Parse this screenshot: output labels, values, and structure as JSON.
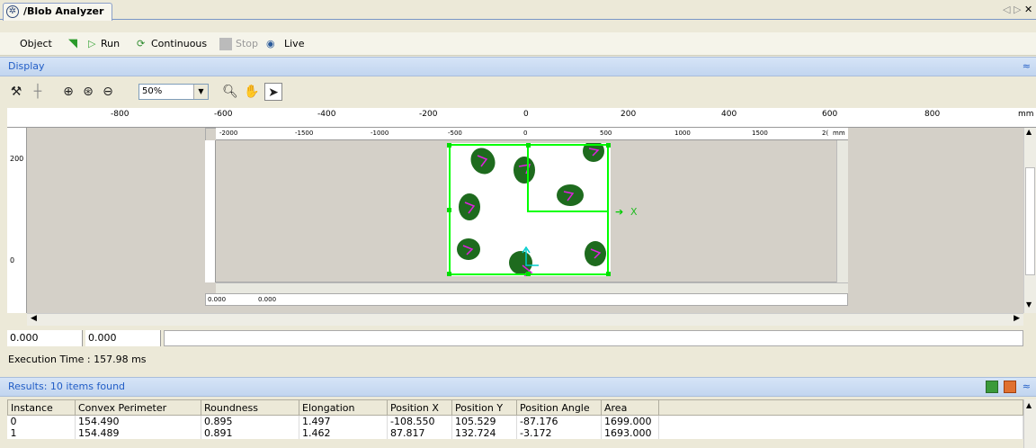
{
  "tab": {
    "title": "/Blob Analyzer"
  },
  "toolbar": {
    "object": "Object",
    "run": "Run",
    "continuous": "Continuous",
    "stop": "Stop",
    "live": "Live"
  },
  "display": {
    "header": "Display",
    "zoom": "50%"
  },
  "ruler": {
    "top": [
      "-800",
      "-600",
      "-400",
      "-200",
      "0",
      "200",
      "400",
      "600",
      "800",
      "mm"
    ],
    "left": [
      "200",
      "0"
    ],
    "inner_top": [
      "-2000",
      "-1500",
      "-1000",
      "-500",
      "0",
      "500",
      "1000",
      "1500",
      "2(",
      "mm"
    ]
  },
  "overlay": {
    "x_label": "X"
  },
  "inner_coords": {
    "a": "0.000",
    "b": "0.000"
  },
  "coords": {
    "x": "0.000",
    "y": "0.000"
  },
  "exec_time": "Execution Time : 157.98 ms",
  "results": {
    "header": "Results: 10 items found",
    "columns": [
      "Instance",
      "Convex Perimeter",
      "Roundness",
      "Elongation",
      "Position X",
      "Position Y",
      "Position Angle",
      "Area"
    ],
    "rows": [
      [
        "0",
        "154.490",
        "0.895",
        "1.497",
        "-108.550",
        "105.529",
        "-87.176",
        "1699.000"
      ],
      [
        "1",
        "154.489",
        "0.891",
        "1.462",
        "87.817",
        "132.724",
        "-3.172",
        "1693.000"
      ]
    ]
  }
}
